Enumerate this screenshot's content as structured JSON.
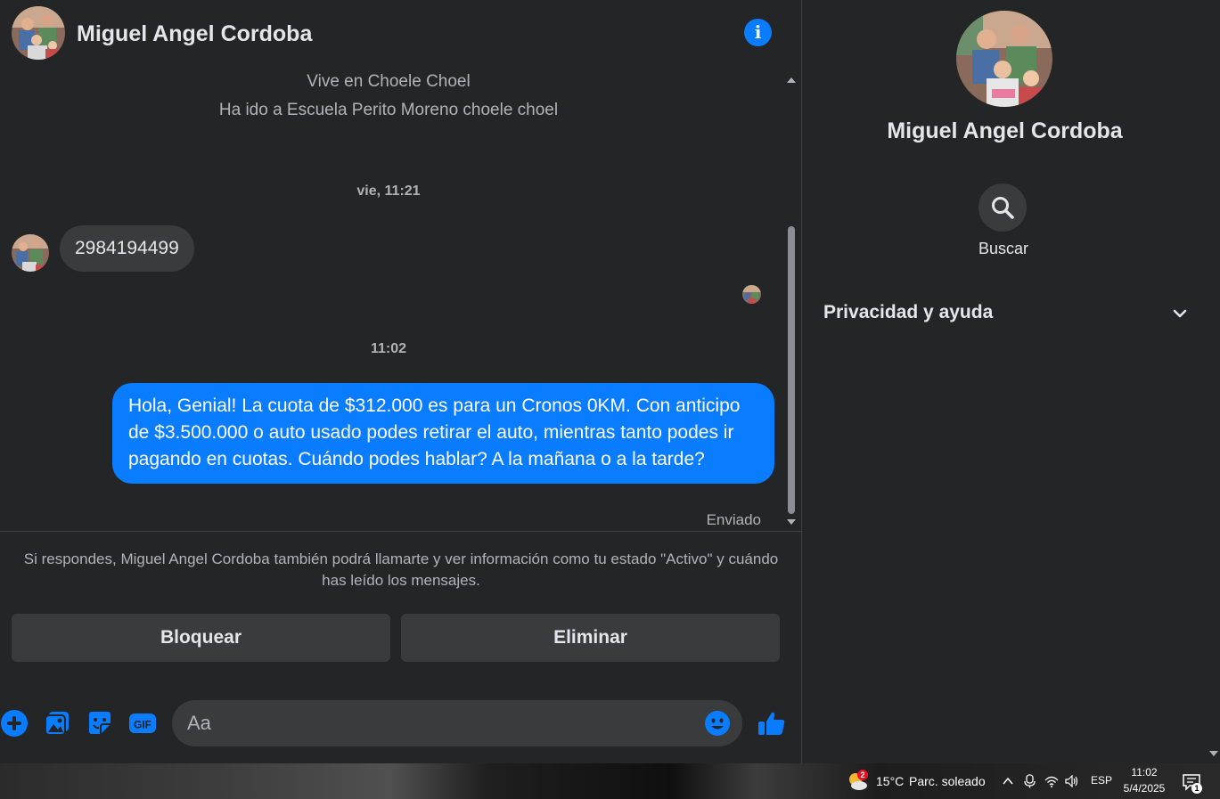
{
  "contact": {
    "name": "Miguel Angel Cordoba"
  },
  "thread": {
    "bio_lines": [
      "Vive en Choele Choel",
      "Ha ido a Escuela Perito Moreno choele choel"
    ],
    "timestamps": [
      "vie, 11:21",
      "11:02"
    ],
    "incoming_message": "2984194499",
    "outgoing_message": "Hola, Genial! La cuota de $312.000 es para un Cronos 0KM. Con anticipo de $3.500.000 o auto usado podes retirar el auto, mientras tanto podes ir pagando en cuotas. Cuándo podes hablar? A la mañana o a la tarde?",
    "status": "Enviado"
  },
  "request_notice": "Si respondes, Miguel Angel Cordoba también podrá llamarte y ver información como tu estado \"Activo\" y cuándo has leído los mensajes.",
  "actions": {
    "block_label": "Bloquear",
    "delete_label": "Eliminar"
  },
  "composer": {
    "placeholder": "Aa",
    "icons": [
      "plus-icon",
      "image-icon",
      "sticker-icon",
      "gif-icon",
      "emoji-icon",
      "thumbs-up-icon"
    ],
    "gif_text": "GIF"
  },
  "side_panel": {
    "search_label": "Buscar",
    "privacy_label": "Privacidad y ayuda"
  },
  "taskbar": {
    "weather_badge": "2",
    "temperature": "15°C",
    "condition": "Parc. soleado",
    "language": "ESP",
    "time": "11:02",
    "date": "5/4/2025",
    "notification_count": "1"
  },
  "colors": {
    "background": "#242526",
    "accent": "#0a7cff",
    "bubble_incoming": "#3a3b3c",
    "text_primary": "#e4e6eb",
    "text_secondary": "#b0b3b8"
  }
}
